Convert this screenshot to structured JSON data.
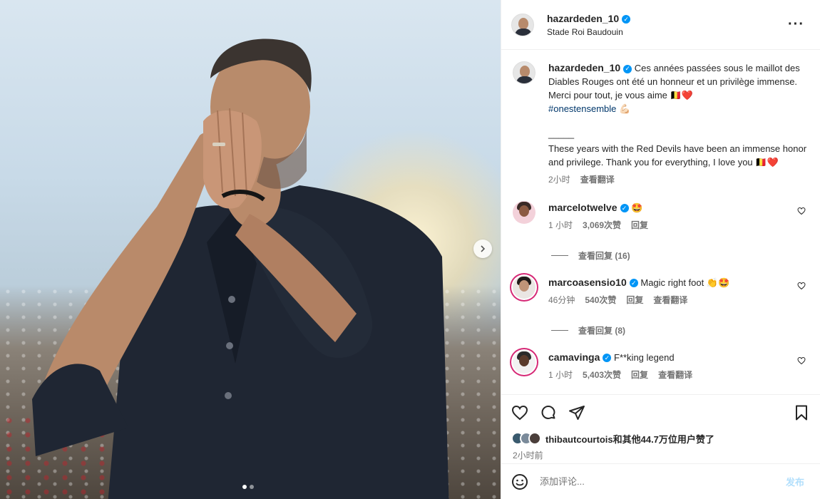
{
  "post": {
    "author": {
      "username": "hazardeden_10",
      "location": "Stade Roi Baudouin"
    },
    "caption": {
      "username": "hazardeden_10",
      "text_fr": "Ces années passées sous le maillot des Diables Rouges ont été un honneur et un privilège immense. Merci pour tout, je vous aime 🇧🇪❤️",
      "hashtag": "#onestensemble",
      "hashtag_emoji": "💪🏻",
      "separator": "_____",
      "text_en": "These years with the Red Devils have been an immense honor and privilege. Thank you for everything, I love you 🇧🇪❤️",
      "time": "2小时",
      "translate": "查看翻译"
    },
    "comments": [
      {
        "username": "marcelotwelve",
        "text": "🤩",
        "time": "1 小时",
        "likes": "3,069次赞",
        "reply": "回复",
        "translate": "",
        "view_replies": "查看回复 (16)"
      },
      {
        "username": "marcoasensio10",
        "text": "Magic right foot 👏🤩",
        "time": "46分钟",
        "likes": "540次赞",
        "reply": "回复",
        "translate": "查看翻译",
        "view_replies": "查看回复 (8)"
      },
      {
        "username": "camavinga",
        "text": "F**king legend",
        "time": "1 小时",
        "likes": "5,403次赞",
        "reply": "回复",
        "translate": "查看翻译"
      }
    ],
    "likes_text": "thibautcourtois和其他44.7万位用户赞了",
    "posted_time": "2小时前",
    "add_comment_placeholder": "添加评论...",
    "post_button": "发布",
    "carousel": {
      "current": 1,
      "total": 2
    }
  },
  "colors": {
    "verified": "#0095f6",
    "link": "#00376b",
    "muted": "#737373",
    "post_button": "#b2dffc",
    "story_ring": "#d62976"
  },
  "icons": [
    "more-icon",
    "heart-icon",
    "comment-icon",
    "share-icon",
    "bookmark-icon",
    "emoji-icon",
    "chevron-right-icon",
    "verified-badge-icon"
  ]
}
